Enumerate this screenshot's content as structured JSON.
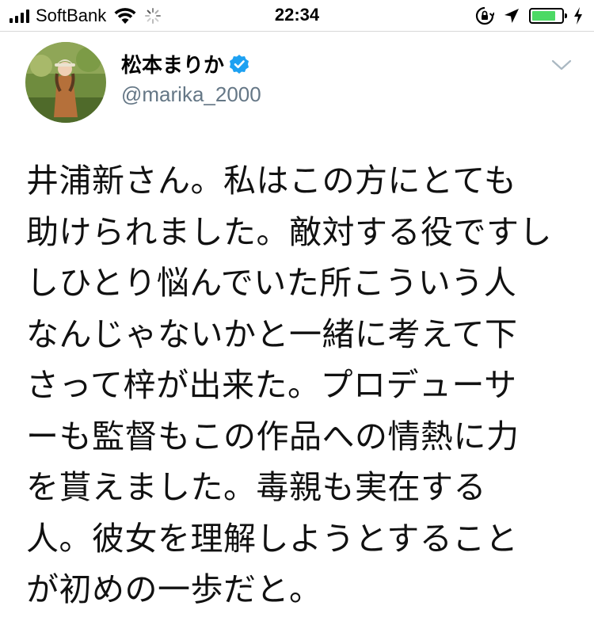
{
  "status_bar": {
    "carrier": "SoftBank",
    "time": "22:34",
    "battery_level": 0.8,
    "icons": [
      "signal-icon",
      "wifi-icon",
      "loading-spinner-icon",
      "orientation-lock-icon",
      "location-arrow-icon",
      "battery-icon",
      "charging-bolt-icon"
    ]
  },
  "tweet": {
    "display_name": "松本まりか",
    "handle": "@marika_2000",
    "verified": true,
    "lines": [
      "井浦新さん。私はこの方にとても",
      "助けられました。敵対する役ですし",
      "しひとり悩んでいた所こういう人",
      "なんじゃないかと一緒に考えて下",
      "さって梓が出来た。プロデューサ",
      "ーも監督もこの作品への情熱に力",
      "を貰えました。毒親も実在する",
      "人。彼女を理解しようとすること",
      "が初めの一歩だと。"
    ]
  },
  "colors": {
    "verified_badge": "#1da1f2",
    "handle": "#657786",
    "battery_fill": "#4cd964",
    "caret": "#aab8c2"
  }
}
